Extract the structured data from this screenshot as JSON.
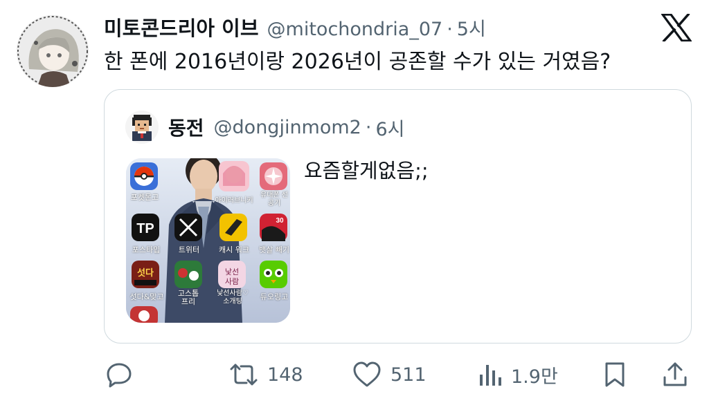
{
  "author": {
    "display_name": "미토콘드리아 이브",
    "handle": "@mitochondria_07",
    "separator": "·",
    "time": "5시"
  },
  "tweet": {
    "text": "한 폰에 2016년이랑 2026년이 공존할 수가 있는 거였음?"
  },
  "quote": {
    "display_name": "동전",
    "handle": "@dongjinmom2",
    "separator": "·",
    "time": "6시",
    "text": "요즘할게없음;;",
    "apps": [
      {
        "label": "포켓몬고",
        "icon": "pokeball-icon",
        "color": "#e3350d"
      },
      {
        "label": "아이러브니키",
        "icon": "character-icon",
        "color": "#f7c5d0"
      },
      {
        "label": "유대폰 선공기",
        "icon": "fan-icon",
        "color": "#e46a7a"
      },
      {
        "label": "포스타입",
        "icon": "postype-icon",
        "color": "#111111"
      },
      {
        "label": "트위터",
        "icon": "x-icon",
        "color": "#111111"
      },
      {
        "label": "캐시 워크",
        "icon": "shoe-icon",
        "color": "#f2c200"
      },
      {
        "label": "뱃살 빼기",
        "icon": "thirty-icon",
        "color": "#d02233"
      },
      {
        "label": "섯다&맞고",
        "icon": "cards-icon",
        "color": "#7a1f16"
      },
      {
        "label": "고스톱 프리",
        "icon": "gostop-icon",
        "color": "#2d7a3a"
      },
      {
        "label": "낯선사람♡ 소개팅",
        "icon": "heart-icon",
        "color": "#f3d6e4"
      },
      {
        "label": "듀오링고",
        "icon": "owl-icon",
        "color": "#58cc02"
      }
    ]
  },
  "actions": {
    "reply_icon": "reply-icon",
    "retweet_icon": "retweet-icon",
    "retweet_count": "148",
    "like_icon": "heart-icon",
    "like_count": "511",
    "views_icon": "views-icon",
    "views_count": "1.9만",
    "bookmark_icon": "bookmark-icon",
    "share_icon": "share-icon"
  },
  "colors": {
    "text_primary": "#0f1419",
    "text_secondary": "#536471",
    "border": "#cfd9de",
    "background": "#ffffff"
  }
}
